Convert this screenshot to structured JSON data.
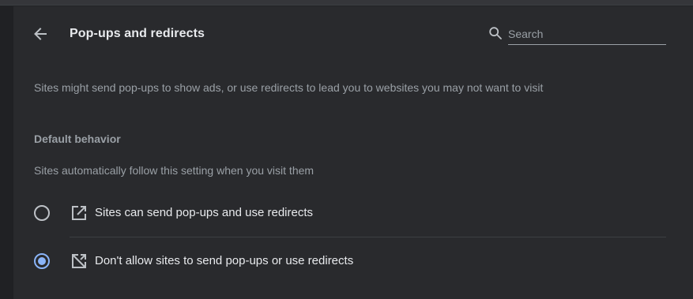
{
  "header": {
    "title": "Pop-ups and redirects",
    "back_icon": "arrow-back-icon"
  },
  "search": {
    "placeholder": "Search",
    "value": "",
    "icon": "search-icon"
  },
  "description": "Sites might send pop-ups to show ads, or use redirects to lead you to websites you may not want to visit",
  "default_behavior": {
    "title": "Default behavior",
    "subtitle": "Sites automatically follow this setting when you visit them",
    "options": [
      {
        "label": "Sites can send pop-ups and use redirects",
        "icon": "open-in-new-icon",
        "selected": false
      },
      {
        "label": "Don't allow sites to send pop-ups or use redirects",
        "icon": "open-in-new-off-icon",
        "selected": true
      }
    ]
  },
  "colors": {
    "background": "#202124",
    "card": "#292a2d",
    "accent": "#8ab4f8",
    "text_primary": "#e8eaed",
    "text_secondary": "#9aa0a6"
  }
}
